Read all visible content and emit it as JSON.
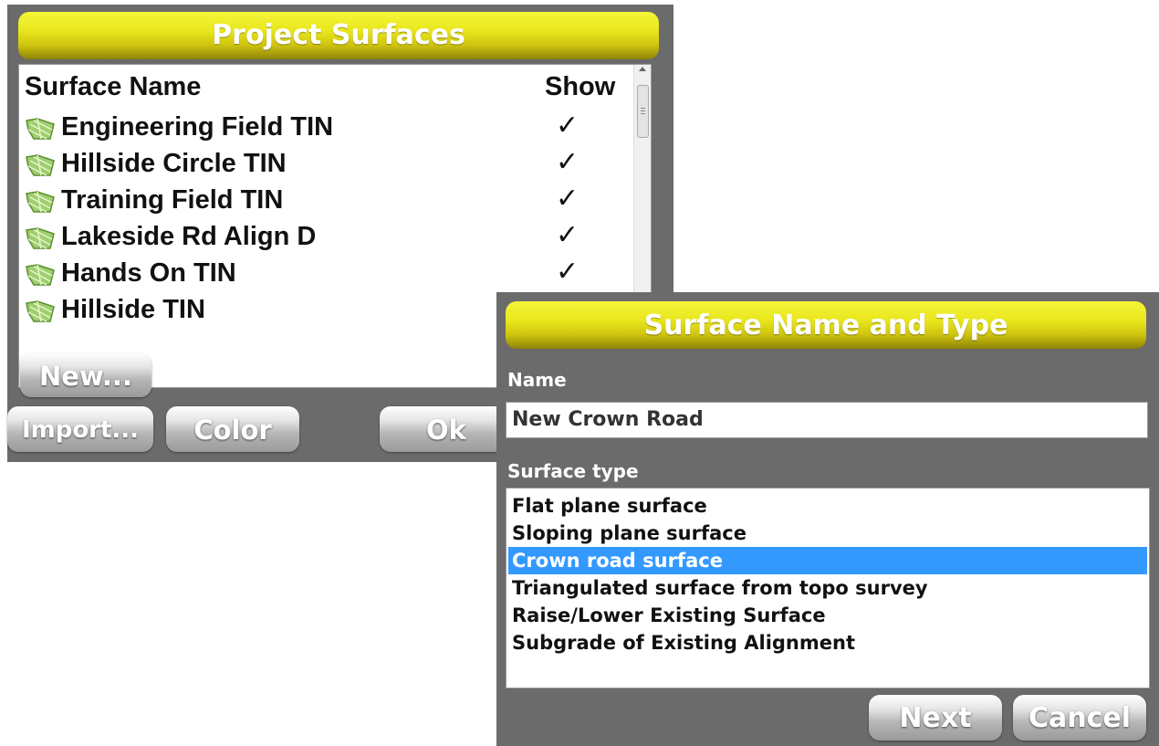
{
  "project_dialog": {
    "title": "Project Surfaces",
    "columns": {
      "name": "Surface Name",
      "show": "Show"
    },
    "surfaces": [
      {
        "name": "Engineering Field TIN",
        "show": "✓"
      },
      {
        "name": "Hillside Circle TIN",
        "show": "✓"
      },
      {
        "name": "Training Field TIN",
        "show": "✓"
      },
      {
        "name": "Lakeside Rd Align D",
        "show": "✓"
      },
      {
        "name": "Hands On TIN",
        "show": "✓"
      },
      {
        "name": "Hillside TIN",
        "show": ""
      }
    ],
    "buttons": {
      "new": "New...",
      "import": "Import...",
      "color": "Color",
      "ok": "Ok"
    }
  },
  "surface_dialog": {
    "title": "Surface Name and Type",
    "name_label": "Name",
    "name_value": "New Crown Road",
    "type_label": "Surface type",
    "types": [
      "Flat plane surface",
      "Sloping plane surface",
      "Crown road surface",
      "Triangulated surface from topo survey",
      "Raise/Lower Existing Surface",
      "Subgrade of Existing Alignment"
    ],
    "selected_type": "Crown road surface",
    "buttons": {
      "next": "Next",
      "cancel": "Cancel"
    }
  },
  "colors": {
    "titlebar": "#e9e61d",
    "dialog_bg": "#6b6b6b",
    "selection": "#3399ff"
  }
}
